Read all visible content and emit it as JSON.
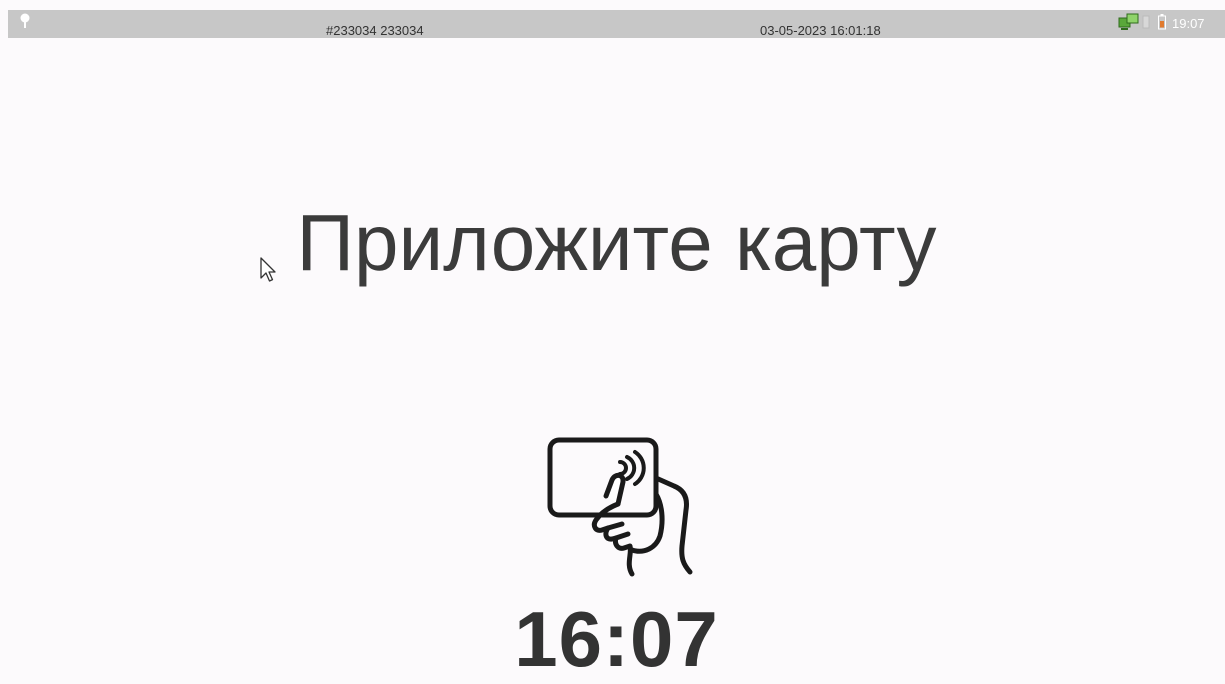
{
  "status_bar": {
    "left_icon": "location-pin-icon",
    "terminal_id": "#233034 233034",
    "datetime": "03-05-2023 16:01:18",
    "network_icon": "network-connection-icon",
    "signal_icon": "signal-icon",
    "battery_icon": "battery-low-icon",
    "clock": "19:07"
  },
  "main": {
    "prompt": "Приложите карту",
    "card_icon": "contactless-card-hand-icon",
    "cursor_icon": "mouse-pointer-icon",
    "timer": "16:07"
  },
  "colors": {
    "background": "#fcfafc",
    "status_bar": "#c7c7c7",
    "text": "#3b3b3b",
    "battery": "#e07a2e",
    "network": "#5aa83a"
  }
}
